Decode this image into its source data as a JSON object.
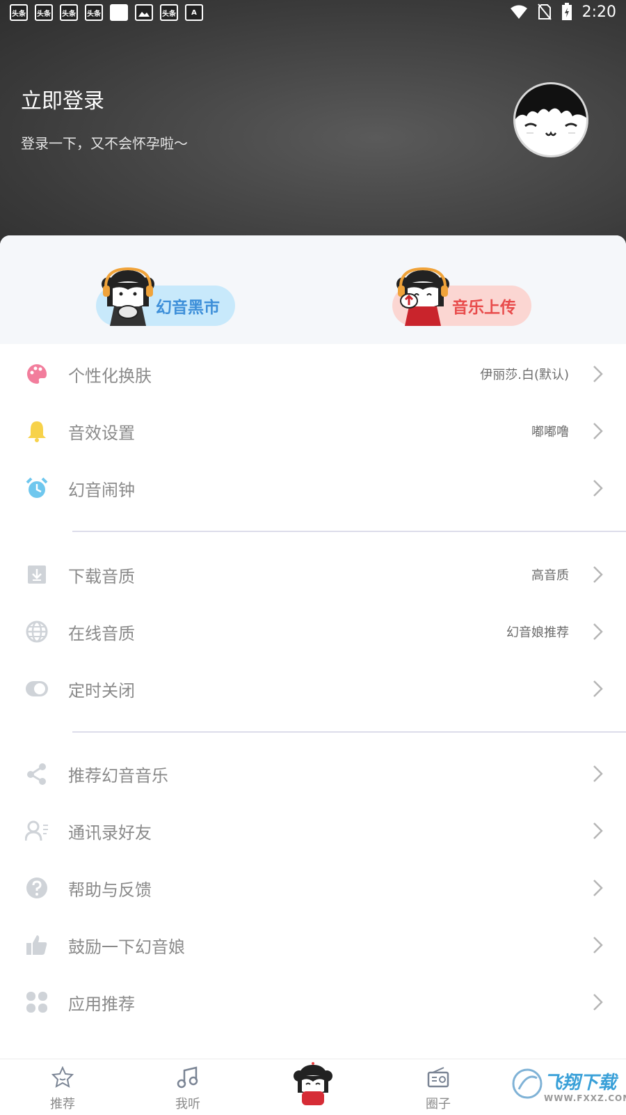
{
  "status_bar": {
    "notifications": [
      "头条",
      "头条",
      "头条",
      "头条",
      "",
      "image",
      "头条",
      "A"
    ],
    "time": "2:20"
  },
  "header": {
    "login_title": "立即登录",
    "login_subtitle": "登录一下，又不会怀孕啦〜"
  },
  "banners": [
    {
      "label": "幻音黑市",
      "color": "#3d8fd9"
    },
    {
      "label": "音乐上传",
      "color": "#e84b4b"
    }
  ],
  "menu": [
    {
      "label": "个性化换肤",
      "value": "伊丽莎.白(默认)",
      "icon": "palette-icon",
      "icon_color": "#f27d9c"
    },
    {
      "label": "音效设置",
      "value": "嘟嘟噜",
      "icon": "bell-icon",
      "icon_color": "#f7d24a"
    },
    {
      "label": "幻音闹钟",
      "value": "",
      "icon": "alarm-clock-icon",
      "icon_color": "#6fc7ee"
    },
    {
      "label": "下载音质",
      "value": "高音质",
      "icon": "download-icon",
      "icon_color": "#cfd3d8"
    },
    {
      "label": "在线音质",
      "value": "幻音娘推荐",
      "icon": "globe-icon",
      "icon_color": "#cfd3d8"
    },
    {
      "label": "定时关闭",
      "value": "",
      "icon": "toggle-icon",
      "icon_color": "#cfd3d8"
    },
    {
      "label": "推荐幻音音乐",
      "value": "",
      "icon": "share-icon",
      "icon_color": "#cfd3d8"
    },
    {
      "label": "通讯录好友",
      "value": "",
      "icon": "contacts-icon",
      "icon_color": "#cfd3d8"
    },
    {
      "label": "帮助与反馈",
      "value": "",
      "icon": "help-icon",
      "icon_color": "#cfd3d8"
    },
    {
      "label": "鼓励一下幻音娘",
      "value": "",
      "icon": "thumbs-up-icon",
      "icon_color": "#cfd3d8"
    },
    {
      "label": "应用推荐",
      "value": "",
      "icon": "apps-icon",
      "icon_color": "#cfd3d8"
    }
  ],
  "bottom_nav": [
    {
      "label": "推荐",
      "icon": "star-face-icon"
    },
    {
      "label": "我听",
      "icon": "music-note-icon"
    },
    {
      "label": "",
      "icon": "mascot-icon"
    },
    {
      "label": "圈子",
      "icon": "radio-icon"
    }
  ],
  "watermark": {
    "main": "飞翔下载",
    "sub": "WWW.FXXZ.COM"
  }
}
